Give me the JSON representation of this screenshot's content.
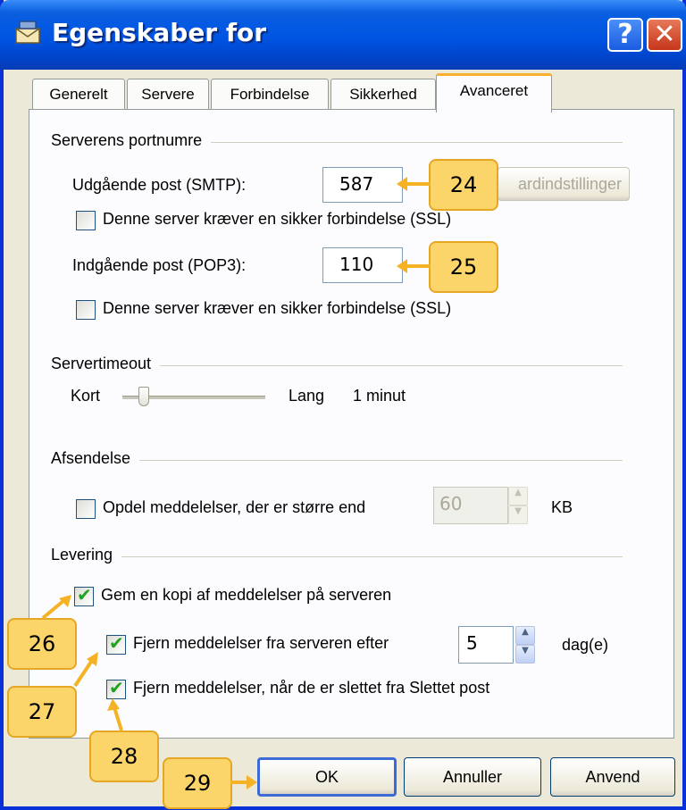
{
  "window": {
    "title": "Egenskaber for",
    "help_label": "?",
    "close_label": "✕"
  },
  "tabs": [
    {
      "label": "Generelt",
      "active": false
    },
    {
      "label": "Servere",
      "active": false
    },
    {
      "label": "Forbindelse",
      "active": false
    },
    {
      "label": "Sikkerhed",
      "active": false
    },
    {
      "label": "Avanceret",
      "active": true
    }
  ],
  "ports": {
    "group_title": "Serverens portnumre",
    "smtp_label": "Udgående post (SMTP):",
    "smtp_value": "587",
    "defaults_button": "ardindstillinger",
    "smtp_ssl_label": "Denne server kræver en sikker forbindelse (SSL)",
    "smtp_ssl_checked": false,
    "pop3_label": "Indgående post (POP3):",
    "pop3_value": "110",
    "pop3_ssl_label": "Denne server kræver en sikker forbindelse (SSL)",
    "pop3_ssl_checked": false
  },
  "timeout": {
    "group_title": "Servertimeout",
    "short_label": "Kort",
    "long_label": "Lang",
    "value_label": "1 minut",
    "slider_level": 0.15
  },
  "sending": {
    "group_title": "Afsendelse",
    "split_label": "Opdel meddelelser, der er større end",
    "split_checked": false,
    "split_value": "60",
    "unit_label": "KB"
  },
  "delivery": {
    "group_title": "Levering",
    "keep_copy_label": "Gem en kopi af meddelelser på serveren",
    "keep_copy_checked": true,
    "remove_after_label": "Fjern meddelelser fra serveren efter",
    "remove_after_checked": true,
    "days_value": "5",
    "days_unit": "dag(e)",
    "remove_deleted_label": "Fjern meddelelser, når de er slettet fra Slettet post",
    "remove_deleted_checked": true
  },
  "buttons": {
    "ok": "OK",
    "cancel": "Annuller",
    "apply": "Anvend"
  },
  "callouts": {
    "c24": "24",
    "c25": "25",
    "c26": "26",
    "c27": "27",
    "c28": "28",
    "c29": "29"
  },
  "colors": {
    "callout_fill": "#fcd56a",
    "callout_border": "#e6a723",
    "titlebar": "#0054e3",
    "checkmark": "#21a121"
  }
}
